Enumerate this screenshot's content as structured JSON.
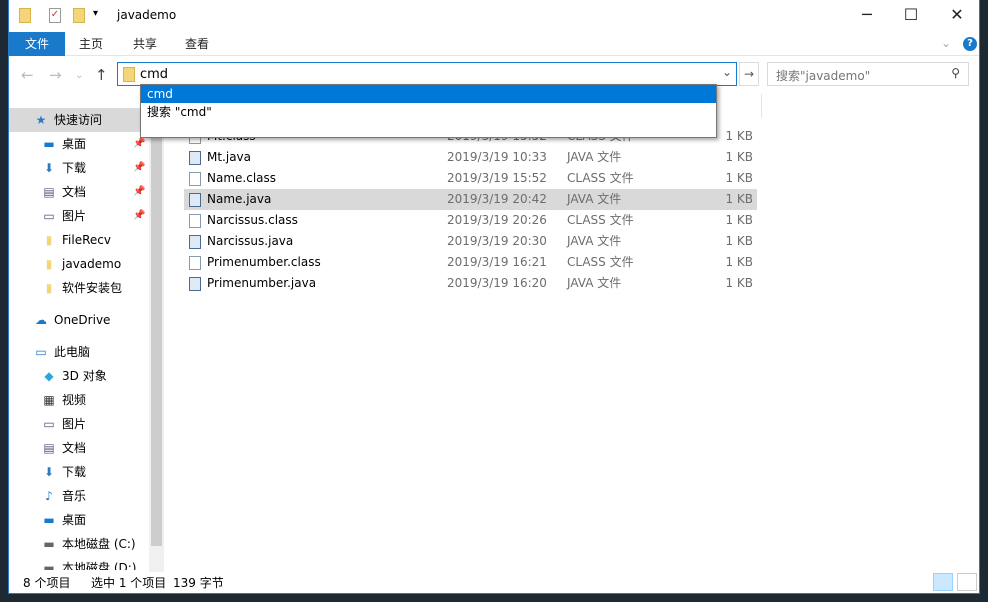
{
  "window": {
    "title": "javademo",
    "minimize": "─",
    "maximize": "☐",
    "close": "✕"
  },
  "ribbon": {
    "tabs": [
      {
        "label": "文件"
      },
      {
        "label": "主页"
      },
      {
        "label": "共享"
      },
      {
        "label": "查看"
      }
    ],
    "expand_icon": "chevron-down-icon",
    "help": "?"
  },
  "address": {
    "value": "cmd",
    "suggestions": [
      {
        "label": "cmd",
        "selected": true
      },
      {
        "label": "搜索 \"cmd\""
      }
    ]
  },
  "search": {
    "placeholder": "搜索\"javademo\""
  },
  "nav": {
    "items": [
      {
        "label": "快速访问",
        "icon": "star-icon",
        "pinned": false
      },
      {
        "label": "桌面",
        "icon": "desktop-icon",
        "pinned": true
      },
      {
        "label": "下载",
        "icon": "download-icon",
        "pinned": true
      },
      {
        "label": "文档",
        "icon": "document-icon",
        "pinned": true
      },
      {
        "label": "图片",
        "icon": "picture-icon",
        "pinned": true
      },
      {
        "label": "FileRecv",
        "icon": "folder-icon"
      },
      {
        "label": "javademo",
        "icon": "folder-icon"
      },
      {
        "label": "软件安装包",
        "icon": "folder-icon"
      },
      {
        "label": "OneDrive",
        "icon": "cloud-icon"
      },
      {
        "label": "此电脑",
        "icon": "computer-icon"
      },
      {
        "label": "3D 对象",
        "icon": "cube-icon"
      },
      {
        "label": "视频",
        "icon": "video-icon"
      },
      {
        "label": "图片",
        "icon": "picture-icon"
      },
      {
        "label": "文档",
        "icon": "document-icon"
      },
      {
        "label": "下载",
        "icon": "download-icon"
      },
      {
        "label": "音乐",
        "icon": "music-icon"
      },
      {
        "label": "桌面",
        "icon": "desktop-icon"
      },
      {
        "label": "本地磁盘 (C:)",
        "icon": "drive-icon"
      },
      {
        "label": "本地磁盘 (D:)",
        "icon": "drive-icon"
      }
    ]
  },
  "files": [
    {
      "name": "Mt.class",
      "date": "2019/3/19 15:52",
      "type": "CLASS 文件",
      "size": "1 KB",
      "kind": "class"
    },
    {
      "name": "Mt.java",
      "date": "2019/3/19 10:33",
      "type": "JAVA 文件",
      "size": "1 KB",
      "kind": "java"
    },
    {
      "name": "Name.class",
      "date": "2019/3/19 15:52",
      "type": "CLASS 文件",
      "size": "1 KB",
      "kind": "class"
    },
    {
      "name": "Name.java",
      "date": "2019/3/19 20:42",
      "type": "JAVA 文件",
      "size": "1 KB",
      "kind": "java",
      "selected": true
    },
    {
      "name": "Narcissus.class",
      "date": "2019/3/19 20:26",
      "type": "CLASS 文件",
      "size": "1 KB",
      "kind": "class"
    },
    {
      "name": "Narcissus.java",
      "date": "2019/3/19 20:30",
      "type": "JAVA 文件",
      "size": "1 KB",
      "kind": "java"
    },
    {
      "name": "Primenumber.class",
      "date": "2019/3/19 16:21",
      "type": "CLASS 文件",
      "size": "1 KB",
      "kind": "class"
    },
    {
      "name": "Primenumber.java",
      "date": "2019/3/19 16:20",
      "type": "JAVA 文件",
      "size": "1 KB",
      "kind": "java"
    }
  ],
  "status": {
    "count": "8 个项目",
    "selection": "选中 1 个项目",
    "size": "139 字节"
  },
  "colors": {
    "accent": "#0078d7",
    "file_tab": "#1979ca",
    "selected_row": "#d9d9d9"
  }
}
